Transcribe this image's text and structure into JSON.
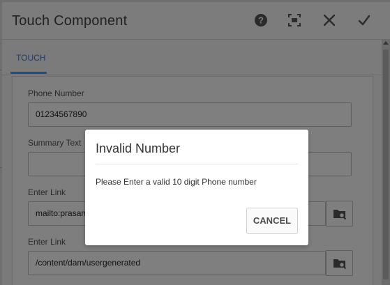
{
  "dialog": {
    "title": "Touch Component",
    "icons": [
      "help-icon",
      "fullscreen-icon",
      "close-icon",
      "check-icon"
    ]
  },
  "tabs": [
    {
      "label": "TOUCH",
      "active": true
    }
  ],
  "form": {
    "phone_number": {
      "label": "Phone Number",
      "value": "01234567890"
    },
    "summary_text": {
      "label": "Summary Text",
      "value": ""
    },
    "enter_link_1": {
      "label": "Enter Link",
      "value": "mailto:prasan"
    },
    "enter_link_2": {
      "label": "Enter Link",
      "value": "/content/dam/usergenerated"
    }
  },
  "modal": {
    "title": "Invalid Number",
    "message": "Please Enter a valid 10 digit Phone number",
    "cancel_label": "CANCEL"
  },
  "colors": {
    "overlay_gray": "#7a7a7a",
    "tab_accent": "#1e4f8a",
    "modal_bg": "#ffffff"
  }
}
